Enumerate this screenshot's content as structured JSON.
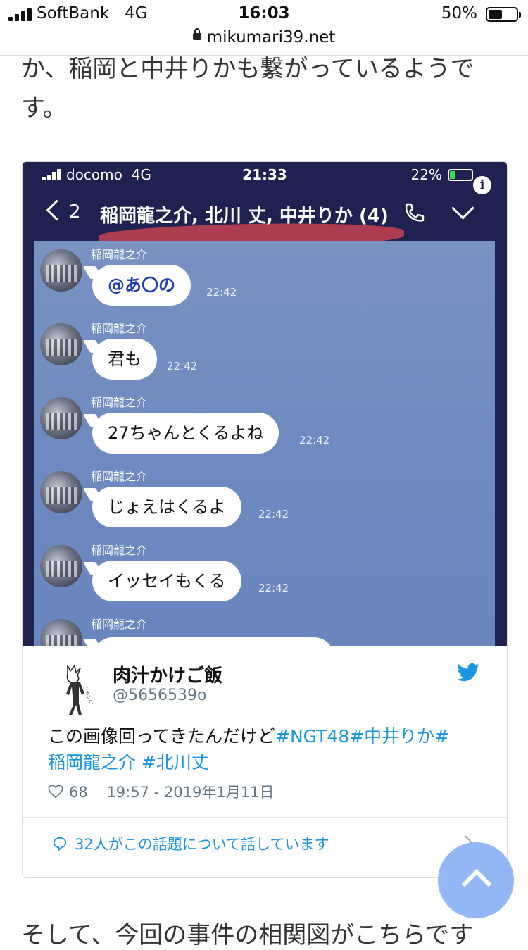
{
  "status_bar": {
    "carrier": "SoftBank",
    "network": "4G",
    "time": "16:03",
    "battery_pct": "50%",
    "battery_level": 0.5
  },
  "browser": {
    "url": "mikumari39.net"
  },
  "article": {
    "text_top": "か、稲岡と中井りかも繋がっているようです。",
    "text_bottom": "そして、今回の事件の相関図がこちらです"
  },
  "screenshot": {
    "status": {
      "carrier": "docomo",
      "network": "4G",
      "time": "21:33",
      "battery_pct": "22%",
      "battery_level": 0.22
    },
    "header": {
      "back_count": "2",
      "title": "稲岡龍之介, 北川 丈, 中井りか (4)"
    },
    "messages": [
      {
        "sender": "稲岡龍之介",
        "text": "@あ〇の",
        "time": "22:42"
      },
      {
        "sender": "稲岡龍之介",
        "text": "君も",
        "time": "22:42"
      },
      {
        "sender": "稲岡龍之介",
        "text": "27ちゃんとくるよね",
        "time": "22:42"
      },
      {
        "sender": "稲岡龍之介",
        "text": "じょえはくるよ",
        "time": "22:42"
      },
      {
        "sender": "稲岡龍之介",
        "text": "イッセイもくる",
        "time": "22:42"
      },
      {
        "sender": "稲岡龍之介",
        "text": "",
        "time": ""
      }
    ]
  },
  "tweet": {
    "name": "肉汁かけご飯",
    "handle": "@5656539o",
    "text_plain": "この画像回ってきたんだけど",
    "tags_line1": "#NGT48#中井りか#",
    "tags_line2": "稲岡龍之介 #北川丈",
    "likes": "68",
    "timestamp": "19:57 - 2019年1月11日",
    "discussion": "32人がこの話題について話しています"
  },
  "icons": {
    "lock": "lock-icon",
    "back": "chevron-left-icon",
    "phone": "phone-icon",
    "expand": "chevron-down-icon",
    "info": "info-icon",
    "twitter": "twitter-bird-icon",
    "heart": "heart-icon",
    "reply": "speech-bubble-icon",
    "scroll_top": "chevron-up-icon"
  },
  "colors": {
    "twitter_blue": "#1b95e0",
    "line_header": "#1f2150",
    "highlight_red": "#d0444f",
    "scroll_button": "#8bb3f5"
  }
}
